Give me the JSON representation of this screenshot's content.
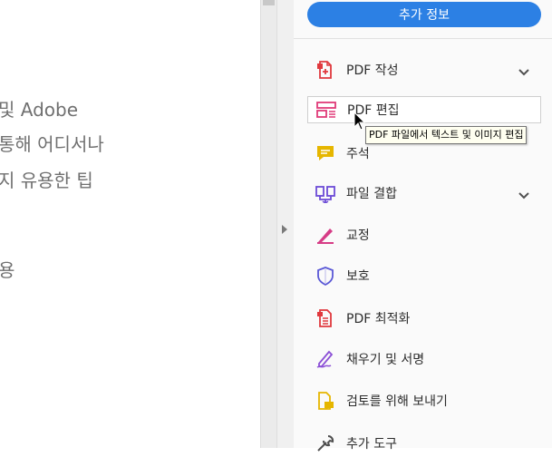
{
  "document": {
    "lines": [
      "및 Adobe",
      "통해 어디서나",
      "지 유용한 팁",
      "용"
    ]
  },
  "panel": {
    "more_info_button": "추가 정보",
    "tools": [
      {
        "label": "PDF 작성",
        "icon": "create-pdf-icon",
        "has_chevron": true
      },
      {
        "label": "PDF 편집",
        "icon": "edit-pdf-icon",
        "active": true
      },
      {
        "label": "주석",
        "icon": "comment-icon"
      },
      {
        "label": "파일 결합",
        "icon": "combine-files-icon",
        "has_chevron": true
      },
      {
        "label": "교정",
        "icon": "redact-icon"
      },
      {
        "label": "보호",
        "icon": "protect-icon"
      },
      {
        "label": "PDF 최적화",
        "icon": "optimize-pdf-icon"
      },
      {
        "label": "채우기 및 서명",
        "icon": "fill-sign-icon"
      },
      {
        "label": "검토를 위해 보내기",
        "icon": "send-for-review-icon"
      },
      {
        "label": "추가 도구",
        "icon": "more-tools-icon"
      }
    ]
  },
  "tooltip": "PDF 파일에서 텍스트 및 이미지 편집",
  "colors": {
    "accent": "#2c80e4",
    "create": "#e0393e",
    "edit": "#e03a78",
    "comment": "#e6b600",
    "combine": "#6c4bd6",
    "redact": "#d63c86",
    "protect": "#5a58d6",
    "optimize": "#e0393e",
    "fill_sign": "#8b4fd6",
    "review": "#e6b600",
    "more": "#505050"
  }
}
